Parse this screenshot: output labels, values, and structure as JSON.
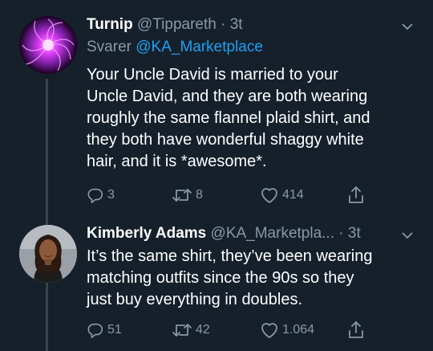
{
  "tweets": [
    {
      "name": "Turnip",
      "handle": "@Tippareth",
      "time": "· 3t",
      "reply_prefix": "Svarer",
      "reply_mention": "@KA_Marketplace",
      "text_lines": [
        "Your Uncle David is married to your",
        "Uncle David, and they are both wearing",
        "roughly the same flannel plaid shirt, and",
        "they both have wonderful shaggy white",
        "hair, and it is *awesome*."
      ],
      "replies": "3",
      "retweets": "8",
      "likes": "414",
      "avatar_icon": "purple-kaleidoscope-avatar"
    },
    {
      "name": "Kimberly Adams",
      "handle": "@KA_Marketpla...",
      "time": "· 3t",
      "text_lines": [
        "It’s the same shirt, they’ve been wearing",
        "matching outfits since the 90s so they",
        "just buy everything in doubles."
      ],
      "replies": "51",
      "retweets": "42",
      "likes": "1.064",
      "avatar_icon": "woman-portrait-avatar"
    }
  ],
  "colors": {
    "background": "#15202b",
    "text": "#ffffff",
    "secondary": "#8899a6",
    "accent": "#1da1f2",
    "thread_line": "#38444d"
  }
}
